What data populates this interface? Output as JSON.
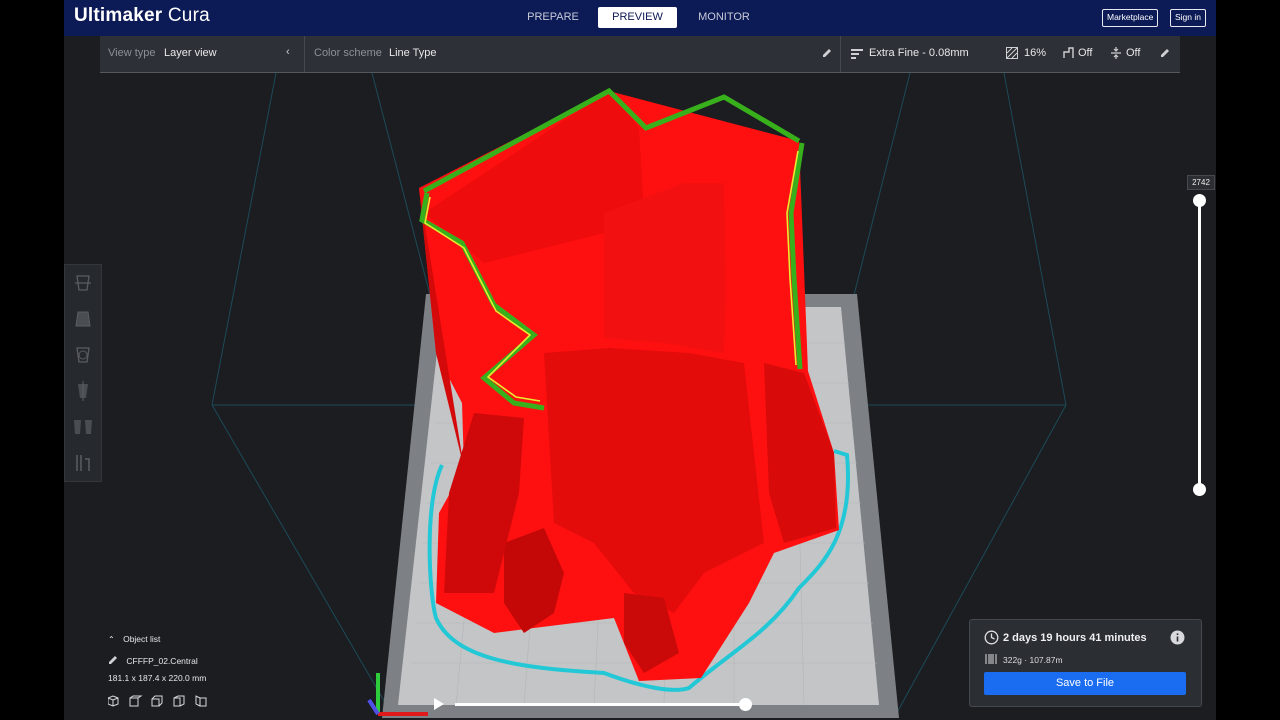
{
  "app": {
    "name_bold": "Ultimaker",
    "name_light": "Cura"
  },
  "stages": {
    "prepare": "PREPARE",
    "preview": "PREVIEW",
    "monitor": "MONITOR"
  },
  "header_buttons": {
    "marketplace": "Marketplace",
    "signin": "Sign in"
  },
  "toolbar": {
    "view_type_label": "View type",
    "view_type_value": "Layer view",
    "color_scheme_label": "Color scheme",
    "color_scheme_value": "Line Type",
    "profile": "Extra Fine - 0.08mm",
    "infill": "16%",
    "support": "Off",
    "adhesion": "Off"
  },
  "layer_slider": {
    "current_layer": "2742"
  },
  "object_list": {
    "title": "Object list",
    "object_name": "CFFFP_02.Central",
    "dimensions": "181.1 x 187.4 x 220.0 mm"
  },
  "print_info": {
    "time": "2 days 19 hours 41 minutes",
    "material": "322g · 107.87m",
    "save_label": "Save to File"
  },
  "colors": {
    "header": "#0c1a56",
    "accent": "#1a6cf0",
    "model_wall": "#ff1010",
    "outer_wall": "#38b01c",
    "skirt": "#22c8d6"
  }
}
